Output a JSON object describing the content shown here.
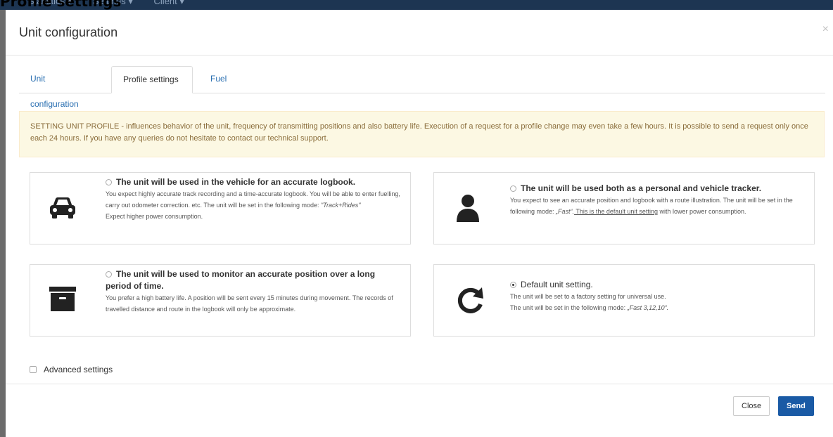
{
  "page": {
    "heading": "Profile settings"
  },
  "topnav": {
    "items": [
      "Statistics ▾",
      "Settings ▾",
      "Client ▾"
    ]
  },
  "modal": {
    "title": "Unit configuration",
    "close_glyph": "×"
  },
  "tabs": [
    {
      "label": "Unit configuration",
      "active": false
    },
    {
      "label": "Profile settings",
      "active": true
    },
    {
      "label": "Fuel",
      "active": false
    }
  ],
  "alert": {
    "text": "SETTING UNIT PROFILE - influences behavior of the unit, frequency of transmitting positions and also battery life. Execution of a request for a profile change may even take a few hours. It is possible to send a request only once each 24 hours. If you have any queries do not hesitate to contact our technical support."
  },
  "profiles": {
    "logbook": {
      "icon": "car-icon",
      "selected": false,
      "title": "The unit will be used in the vehicle for an accurate logbook.",
      "text1": "You expect highly accurate track recording and a time-accurate logbook. You will be able to enter fuelling, carry out odometer correction. etc. The unit will be set in the following mode: ",
      "mode": "\"Track+Rides\"",
      "text2": "Expect higher power consumption."
    },
    "personal": {
      "icon": "person-icon",
      "selected": false,
      "title": "The unit will be used both as a personal and vehicle tracker.",
      "text1": "You expect to see an accurate position and logbook with a route illustration. The unit will be set in the following mode: ",
      "mode": "„Fast“.",
      "default_note": " This is the default unit setting",
      "text2": " with lower power consumption."
    },
    "longterm": {
      "icon": "archive-box-icon",
      "selected": false,
      "title": "The unit will be used to monitor an accurate position over a long period of time.",
      "text1": "You prefer a high battery life. A position will be sent every 15 minutes during movement. The records of travelled distance and route in the logbook will only be approximate."
    },
    "default": {
      "icon": "refresh-icon",
      "selected": true,
      "title": "Default unit setting.",
      "text1": "The unit will be set to a factory setting for universal use.",
      "text2": "The unit will be set in the following mode: ",
      "mode": "„Fast 3,12,10“."
    }
  },
  "advanced": {
    "label": "Advanced settings",
    "checked": false
  },
  "buttons": {
    "close": "Close",
    "send": "Send"
  },
  "colors": {
    "primary": "#1a5aa5",
    "link": "#2a6fb1",
    "alert_bg": "#fcf8e3",
    "alert_text": "#8a6d3b",
    "navbar": "#1d3552"
  }
}
